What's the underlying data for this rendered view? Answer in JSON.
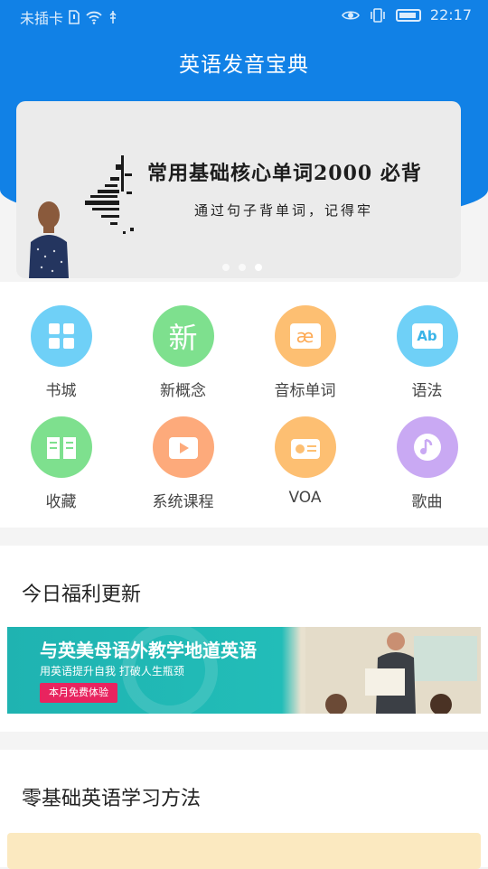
{
  "status_bar": {
    "carrier": "未插卡",
    "time": "22:17"
  },
  "header": {
    "title": "英语发音宝典"
  },
  "banner": {
    "title": "常用基础核心单词2000  必背",
    "subtitle": "通过句子背单词，记得牢",
    "dots": 3,
    "active_dot": 2
  },
  "menu": {
    "items": [
      {
        "label": "书城",
        "icon": "grid-icon",
        "color": "#6fd0f7"
      },
      {
        "label": "新概念",
        "icon": "xin-icon",
        "glyph": "新",
        "color": "#7ee08e"
      },
      {
        "label": "音标单词",
        "icon": "phonetic-icon",
        "glyph": "æ",
        "color": "#fdbf72"
      },
      {
        "label": "语法",
        "icon": "ab-icon",
        "glyph": "Ab",
        "color": "#6fd0f7"
      },
      {
        "label": "收藏",
        "icon": "book-icon",
        "color": "#7ee08e"
      },
      {
        "label": "系统课程",
        "icon": "video-icon",
        "color": "#fdaa7b"
      },
      {
        "label": "VOA",
        "icon": "radio-icon",
        "color": "#fdbf72"
      },
      {
        "label": "歌曲",
        "icon": "music-icon",
        "color": "#c9a9f3"
      }
    ]
  },
  "sections": {
    "welfare": {
      "title": "今日福利更新",
      "ad": {
        "title": "与英美母语外教学地道英语",
        "subtitle": "用英语提升自我  打破人生瓶颈",
        "button": "本月免费体验"
      }
    },
    "method": {
      "title": "零基础英语学习方法"
    }
  },
  "colors": {
    "header_blue": "#1181e6",
    "ad_teal": "#1fb3b1",
    "ad_pink": "#e8245f"
  }
}
